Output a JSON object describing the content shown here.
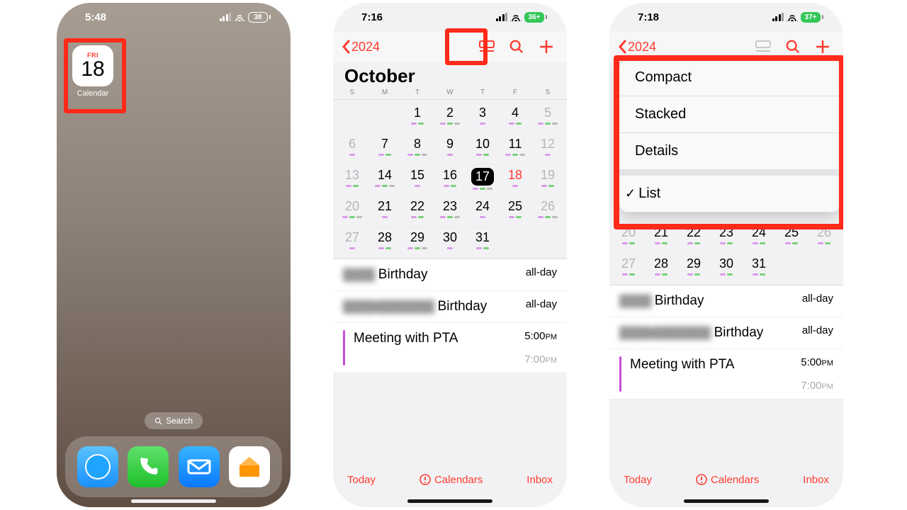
{
  "panel1": {
    "time": "5:48",
    "battery": "38",
    "app": {
      "dow": "FRI",
      "day": "18",
      "label": "Calendar"
    },
    "search": "Search",
    "dock": [
      "safari",
      "phone",
      "mail",
      "home"
    ]
  },
  "panel2": {
    "time": "7:16",
    "battery": "36+",
    "back_year": "2024",
    "month": "October",
    "dow": [
      "S",
      "M",
      "T",
      "W",
      "T",
      "F",
      "S"
    ],
    "days": [
      {
        "n": "",
        "m": true
      },
      {
        "n": "",
        "m": true
      },
      {
        "n": "1"
      },
      {
        "n": "2"
      },
      {
        "n": "3"
      },
      {
        "n": "4"
      },
      {
        "n": "5",
        "m": true
      },
      {
        "n": "6",
        "m": true
      },
      {
        "n": "7"
      },
      {
        "n": "8"
      },
      {
        "n": "9"
      },
      {
        "n": "10"
      },
      {
        "n": "11"
      },
      {
        "n": "12",
        "m": true
      },
      {
        "n": "13",
        "m": true
      },
      {
        "n": "14"
      },
      {
        "n": "15"
      },
      {
        "n": "16"
      },
      {
        "n": "17",
        "today": true
      },
      {
        "n": "18",
        "red": true
      },
      {
        "n": "19",
        "m": true
      },
      {
        "n": "20",
        "m": true
      },
      {
        "n": "21"
      },
      {
        "n": "22"
      },
      {
        "n": "23"
      },
      {
        "n": "24"
      },
      {
        "n": "25"
      },
      {
        "n": "26",
        "m": true
      },
      {
        "n": "27",
        "m": true
      },
      {
        "n": "28"
      },
      {
        "n": "29"
      },
      {
        "n": "30"
      },
      {
        "n": "31"
      },
      {
        "n": "",
        "m": true
      },
      {
        "n": "",
        "m": true
      }
    ],
    "events": [
      {
        "title_pre": "████",
        "title": "Birthday",
        "time": "all-day"
      },
      {
        "title_pre": "████ ███████",
        "title": "Birthday",
        "time": "all-day"
      },
      {
        "title": "Meeting with PTA",
        "time": "5:00",
        "time_sub": "7:00",
        "pm": "PM",
        "bar": true
      }
    ],
    "footer": {
      "today": "Today",
      "calendars": "Calendars",
      "inbox": "Inbox"
    }
  },
  "panel3": {
    "time": "7:18",
    "battery": "37+",
    "back_year": "2024",
    "menu": [
      {
        "label": "Compact"
      },
      {
        "label": "Stacked"
      },
      {
        "label": "Details"
      },
      {
        "sep": true
      },
      {
        "label": "List",
        "checked": true
      }
    ],
    "days_partial_row": [
      "20",
      "21",
      "22",
      "23",
      "24",
      "25",
      "26"
    ],
    "days_last_row": [
      "27",
      "28",
      "29",
      "30",
      "31",
      "",
      ""
    ],
    "events": [
      {
        "title_pre": "████",
        "title": "Birthday",
        "time": "all-day"
      },
      {
        "title_pre": "████ ███████",
        "title": "Birthday",
        "time": "all-day"
      },
      {
        "title": "Meeting with PTA",
        "time": "5:00",
        "time_sub": "7:00",
        "pm": "PM",
        "bar": true
      }
    ],
    "footer": {
      "today": "Today",
      "calendars": "Calendars",
      "inbox": "Inbox"
    }
  }
}
